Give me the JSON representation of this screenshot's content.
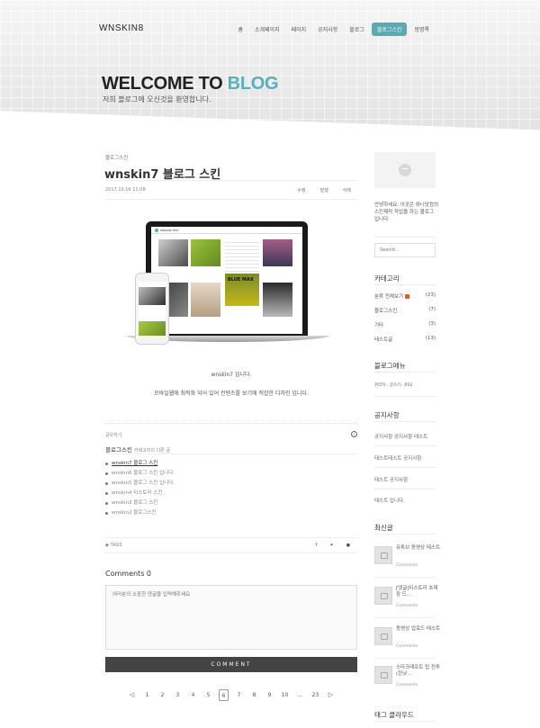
{
  "header": {
    "logo": "WNSKIN8",
    "nav": [
      {
        "label": "홈",
        "active": false
      },
      {
        "label": "소개페이지",
        "active": false
      },
      {
        "label": "페이지",
        "active": false
      },
      {
        "label": "공지사항",
        "active": false
      },
      {
        "label": "블로그",
        "active": false
      },
      {
        "label": "블로그스킨",
        "active": true
      },
      {
        "label": "방명록",
        "active": false
      }
    ],
    "accent_color": "#5aaab2"
  },
  "hero": {
    "title_main": "WELCOME TO ",
    "title_accent": "BLOG",
    "subtitle": "저희 블로그에 오신것을 환영합니다."
  },
  "post": {
    "category": "블로그스킨",
    "title": "wnskin7 블로그 스킨",
    "date": "2017.10.16 11:08",
    "actions": [
      "수정",
      "발행",
      "삭제"
    ],
    "body_line1": "wnskin7 입니다.",
    "body_line2": "모바일웹에 최적화 되어 있어 컨텐츠를 보기에 적합한 디자인 입니다.",
    "mockup_header": "WNSKIN TEST",
    "mockup_overlay": "BLUE MAX"
  },
  "share": {
    "label": "공유하기",
    "info_icon": "info-icon"
  },
  "related": {
    "category": "블로그스킨",
    "subtitle": "카테고리의 다른 글",
    "items": [
      {
        "title": "wnskin7 블로그 스킨",
        "current": true
      },
      {
        "title": "wnskin6 블로그 스킨 입니다.",
        "current": false
      },
      {
        "title": "wnskin5 블로그 스킨 입니다.",
        "current": false
      },
      {
        "title": "wnskin4 티스토리 스킨",
        "current": false
      },
      {
        "title": "wnskin3 블로그 스킨",
        "current": false
      },
      {
        "title": "wnskin2 블로그스킨",
        "current": false
      }
    ]
  },
  "tags": {
    "label": "TAGS",
    "icons": [
      "facebook-icon",
      "twitter-icon",
      "comment-icon"
    ]
  },
  "comments": {
    "title": "Comments 0",
    "placeholder": "여러분의 소중한 댓글을 입력해주세요",
    "submit": "COMMENT"
  },
  "pagination": {
    "prev": "◁",
    "next": "▷",
    "pages": [
      "1",
      "2",
      "3",
      "4",
      "5",
      "6",
      "7",
      "8",
      "9",
      "10",
      "...",
      "23"
    ],
    "current": "6"
  },
  "sidebar": {
    "intro": "안녕하세요. 이곳은 와니닷컴의 스킨제작 작업을 하는 블로그 입니다.",
    "search_placeholder": "Search...",
    "category_title": "카테고리",
    "categories": [
      {
        "label": "분류 전체보기",
        "count": "(23)",
        "new": true
      },
      {
        "label": "블로그스킨",
        "count": "(7)",
        "new": false
      },
      {
        "label": "기타",
        "count": "(3)",
        "new": false
      },
      {
        "label": "테스트글",
        "count": "(13)",
        "new": false
      }
    ],
    "menu_title": "블로그메뉴",
    "menu_text": "관리자 · 글쓰기 · RSS",
    "notice_title": "공지사항",
    "notices": [
      "공지사항 공지사항 테스트",
      "테스트테스트 공지사항",
      "테스트 공지사항",
      "테스트 입니다."
    ],
    "recent_title": "최신글",
    "recent": [
      {
        "title": "유튜브 동영상 테스트",
        "sub": "Comments"
      },
      {
        "title": "[댓글]티스토리 초대장 드...",
        "sub": "Comments"
      },
      {
        "title": "동영상 업로드 테스트",
        "sub": "Comments"
      },
      {
        "title": "스타크래프트 립 전투(한낮...",
        "sub": "Comments"
      }
    ],
    "tagcloud_title": "태그 클라우드"
  }
}
